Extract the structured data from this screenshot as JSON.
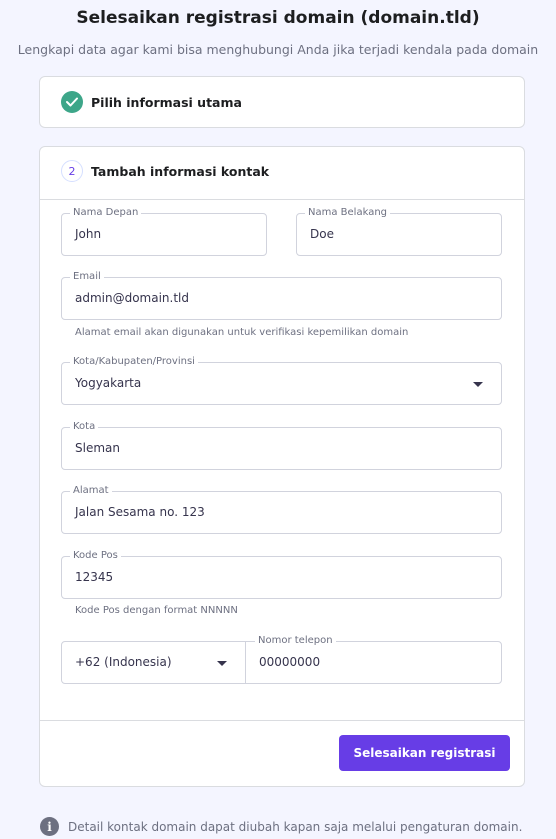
{
  "header": {
    "title": "Selesaikan registrasi domain (domain.tld)",
    "subtitle": "Lengkapi data agar kami bisa menghubungi Anda jika terjadi kendala pada domain"
  },
  "steps": [
    {
      "status": "completed",
      "icon": "check-icon",
      "label": "Pilih informasi utama"
    },
    {
      "status": "active",
      "number": "2",
      "label": "Tambah informasi kontak"
    }
  ],
  "form": {
    "first_name": {
      "label": "Nama Depan",
      "value": "John"
    },
    "last_name": {
      "label": "Nama Belakang",
      "value": "Doe"
    },
    "email": {
      "label": "Email",
      "value": "admin@domain.tld",
      "hint": "Alamat email akan digunakan untuk verifikasi kepemilikan domain"
    },
    "province": {
      "label": "Kota/Kabupaten/Provinsi",
      "value": "Yogyakarta",
      "icon": "chevron-down-icon"
    },
    "city": {
      "label": "Kota",
      "value": "Sleman"
    },
    "address": {
      "label": "Alamat",
      "value": "Jalan Sesama no. 123"
    },
    "postal_code": {
      "label": "Kode Pos",
      "value": "12345",
      "hint": "Kode Pos dengan format NNNNN"
    },
    "phone_code": {
      "value": "+62 (Indonesia)",
      "icon": "chevron-down-icon"
    },
    "phone_number": {
      "label": "Nomor telepon",
      "value": "00000000"
    },
    "submit_label": "Selesaikan registrasi"
  },
  "footer": {
    "icon": "info-icon",
    "text": "Detail kontak domain dapat diubah kapan saja melalui pengaturan domain."
  },
  "colors": {
    "accent": "#673de6",
    "success": "#3da689",
    "background": "#f4f5ff"
  }
}
